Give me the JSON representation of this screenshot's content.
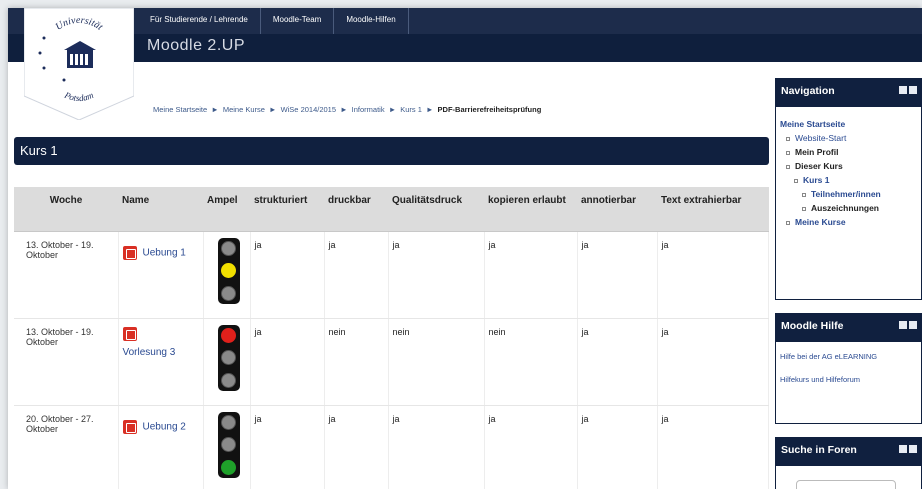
{
  "topnav": {
    "items": [
      "Für Studierende / Lehrende",
      "Moodle-Team",
      "Moodle-Hilfen"
    ]
  },
  "app": {
    "title": "Moodle 2.UP"
  },
  "logo": {
    "text_top": "Universität",
    "text_bottom": "Potsdam"
  },
  "breadcrumb": [
    "Meine Startseite",
    "Meine Kurse",
    "WiSe 2014/2015",
    "Informatik",
    "Kurs 1",
    "PDF-Barrierefreiheitsprüfung"
  ],
  "breadcrumb_sep": "►",
  "course": {
    "title": "Kurs 1"
  },
  "table": {
    "headers": [
      "Woche",
      "Name",
      "Ampel",
      "strukturiert",
      "druckbar",
      "Qualitätsdruck",
      "kopieren erlaubt",
      "annotierbar",
      "Text extrahierbar"
    ],
    "rows": [
      {
        "week": "13. Oktober - 19. Oktober",
        "name": "Uebung 1",
        "ampel": "yellow",
        "strukturiert": "ja",
        "druckbar": "ja",
        "qualitaetsdruck": "ja",
        "kopieren": "ja",
        "annotierbar": "ja",
        "text": "ja"
      },
      {
        "week": "13. Oktober - 19. Oktober",
        "name": "Vorlesung 3",
        "ampel": "red",
        "strukturiert": "ja",
        "druckbar": "nein",
        "qualitaetsdruck": "nein",
        "kopieren": "nein",
        "annotierbar": "ja",
        "text": "ja"
      },
      {
        "week": "20. Oktober - 27. Oktober",
        "name": "Uebung 2",
        "ampel": "green",
        "strukturiert": "ja",
        "druckbar": "ja",
        "qualitaetsdruck": "ja",
        "kopieren": "ja",
        "annotierbar": "ja",
        "text": "ja"
      }
    ]
  },
  "colors": {
    "red": "#e0201b",
    "yellow": "#f2e000",
    "green": "#1fa12a",
    "off": "#8a8a8a",
    "navy": "#10203f"
  },
  "sidebar": {
    "navigation": {
      "title": "Navigation",
      "items": [
        "Meine Startseite",
        "Website-Start",
        "Mein Profil",
        "Dieser Kurs",
        "Kurs 1",
        "Teilnehmer/innen",
        "Auszeichnungen",
        "Meine Kurse"
      ]
    },
    "hilfe": {
      "title": "Moodle Hilfe",
      "items": [
        "Hilfe bei der AG eLEARNING",
        "Hilfekurs und Hilfeforum"
      ]
    },
    "suche": {
      "title": "Suche in Foren"
    }
  }
}
